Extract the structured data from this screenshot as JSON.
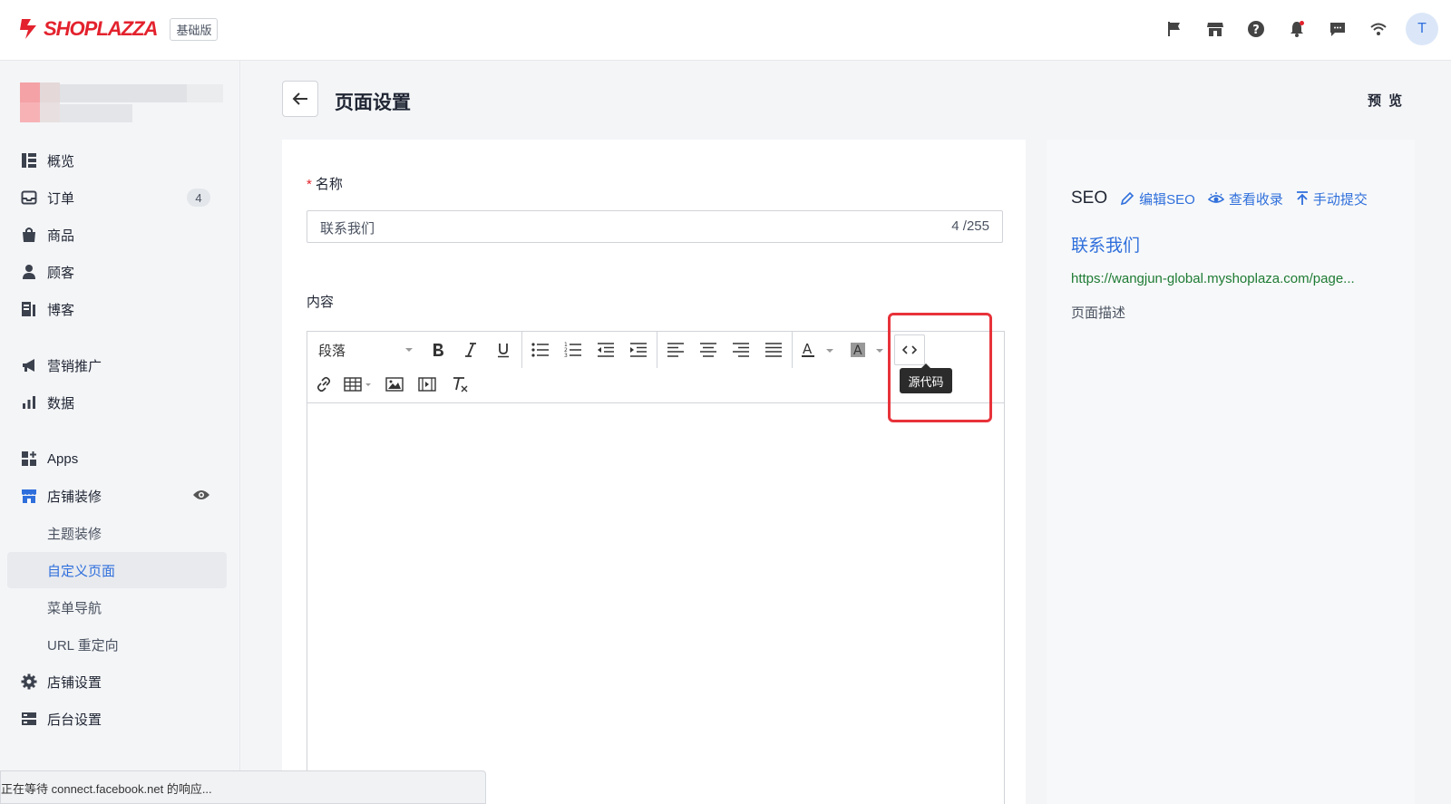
{
  "header": {
    "logo_text": "SHOPLAZZA",
    "plan_badge": "基础版",
    "avatar_initial": "T",
    "icons": [
      "flag-icon",
      "store-icon",
      "help-icon",
      "bell-icon",
      "message-icon",
      "wifi-icon"
    ],
    "brand_color": "#e3222d"
  },
  "sidebar": {
    "items": [
      {
        "label": "概览",
        "icon": "overview-icon"
      },
      {
        "label": "订单",
        "icon": "inbox-icon",
        "badge": "4"
      },
      {
        "label": "商品",
        "icon": "bag-icon"
      },
      {
        "label": "顾客",
        "icon": "person-icon"
      },
      {
        "label": "博客",
        "icon": "blog-icon"
      },
      {
        "label": "营销推广",
        "icon": "megaphone-icon"
      },
      {
        "label": "数据",
        "icon": "bar-chart-icon"
      },
      {
        "label": "Apps",
        "icon": "apps-icon"
      },
      {
        "label": "店铺装修",
        "icon": "storefront-icon"
      },
      {
        "label": "主题装修"
      },
      {
        "label": "自定义页面",
        "active": true
      },
      {
        "label": "菜单导航"
      },
      {
        "label": "URL 重定向"
      },
      {
        "label": "店铺设置",
        "icon": "gear-icon"
      },
      {
        "label": "后台设置",
        "icon": "server-icon"
      }
    ],
    "active_color": "#2f6fdc"
  },
  "page": {
    "title": "页面设置",
    "preview_label": "预 览"
  },
  "form": {
    "name_label": "名称",
    "name_value": "联系我们",
    "name_count": "4 /255",
    "content_label": "内容",
    "paragraph_select": "段落",
    "tooltip": "源代码",
    "toolbar_row1": [
      "bold-icon",
      "italic-icon",
      "underline-icon",
      "bullet-list-icon",
      "numbered-list-icon",
      "outdent-icon",
      "indent-icon",
      "align-left-icon",
      "align-center-icon",
      "align-right-icon",
      "align-justify-icon",
      "text-color-icon",
      "highlight-color-icon",
      "source-code-icon"
    ],
    "toolbar_row2": [
      "link-icon",
      "table-icon",
      "image-icon",
      "video-icon",
      "clear-format-icon"
    ]
  },
  "seo": {
    "title": "SEO",
    "edit_label": "编辑SEO",
    "view_label": "查看收录",
    "submit_label": "手动提交",
    "page_title": "联系我们",
    "url": "https://wangjun-global.myshoplaza.com/page...",
    "description": "页面描述",
    "link_color": "#2f6fdc",
    "url_color": "#1e7b34"
  },
  "status_bar": {
    "text": "正在等待 connect.facebook.net 的响应..."
  }
}
